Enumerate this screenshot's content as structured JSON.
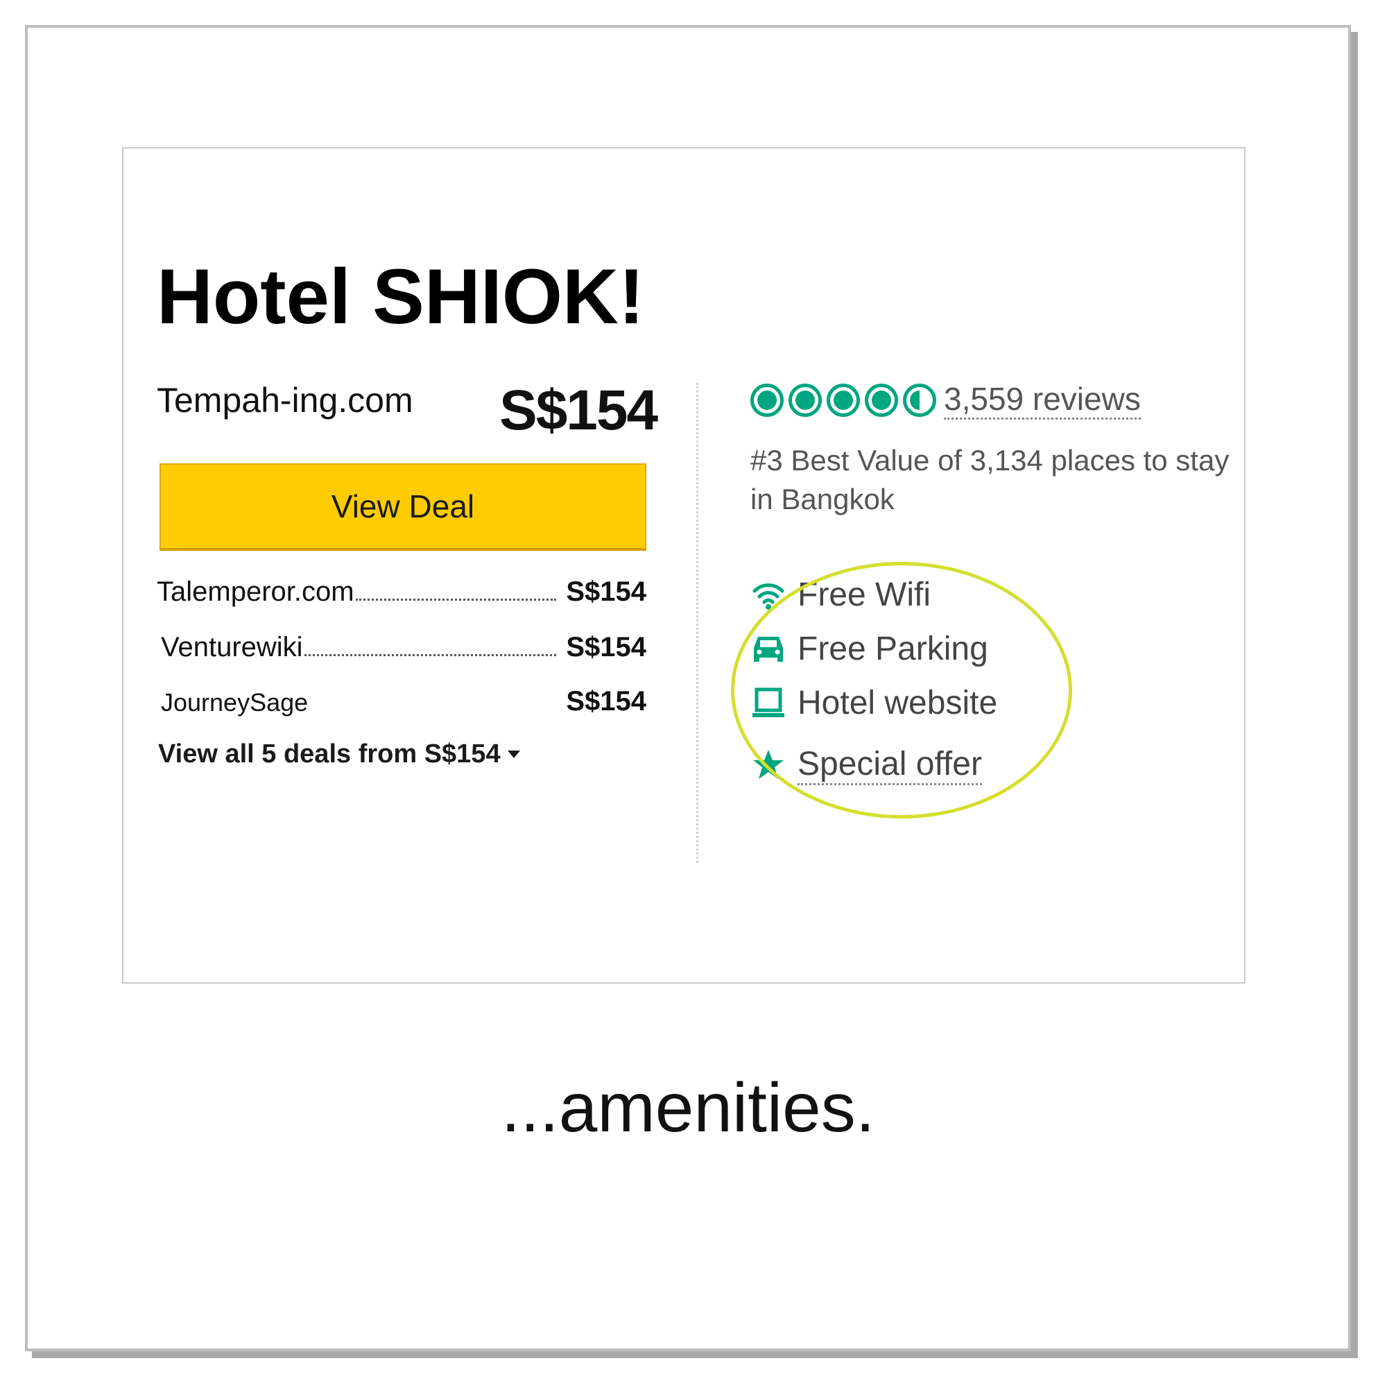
{
  "hotel": {
    "name": "Hotel SHIOK!"
  },
  "featured_deal": {
    "provider": "Tempah-ing.com",
    "price": "S$154",
    "button_label": "View Deal"
  },
  "other_deals": [
    {
      "provider": "Talemperor.com",
      "price": "S$154"
    },
    {
      "provider": "Venturewiki",
      "price": "S$154"
    },
    {
      "provider": "JourneySage",
      "price": "S$154"
    }
  ],
  "view_all_label": "View all 5 deals from S$154",
  "rating": {
    "bubbles": 4.5,
    "max": 5,
    "reviews_label": "3,559 reviews"
  },
  "ranking_text": "#3 Best Value of 3,134 places to stay in Bangkok",
  "amenities": [
    {
      "label": "Free Wifi",
      "icon": "wifi-icon"
    },
    {
      "label": "Free Parking",
      "icon": "car-icon"
    },
    {
      "label": "Hotel website",
      "icon": "laptop-icon"
    },
    {
      "label": "Special offer",
      "icon": "star-icon"
    }
  ],
  "caption": "...amenities.",
  "colors": {
    "accent_green": "#00a680",
    "button_yellow": "#fecc00",
    "highlight_circle": "#d4df2f"
  }
}
